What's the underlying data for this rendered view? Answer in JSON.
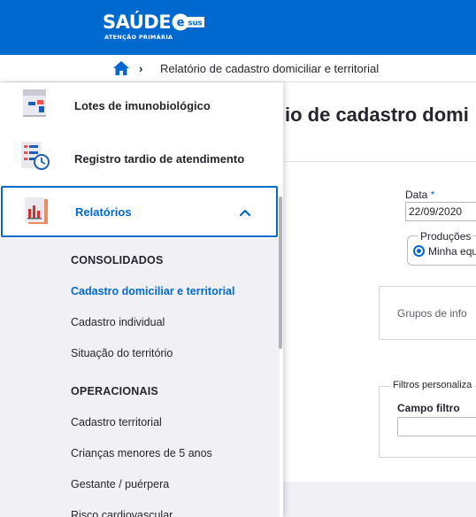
{
  "header": {
    "logo_text": "SAÚDE",
    "logo_sub": "ATENÇÃO PRIMÁRIA",
    "logo_badge": "sus",
    "brand_color": "#0069d0"
  },
  "breadcrumb": {
    "home_icon": "home-icon",
    "separator": "›",
    "current": "Relatório de cadastro domiciliar e territorial"
  },
  "main": {
    "title": "io de cadastro domi",
    "date_label": "Data",
    "date_required": "*",
    "date_value": "22/09/2020",
    "productions_legend": "Produções",
    "productions_option": "Minha equ",
    "groups_text": "Grupos de info",
    "filters_legend": "Filtros personaliza",
    "field_label": "Campo filtro"
  },
  "side_menu": {
    "items": [
      {
        "label": "Lotes de imunobiológico",
        "icon": "vaccine-lot-icon"
      },
      {
        "label": "Registro tardio de atendimento",
        "icon": "late-record-icon"
      },
      {
        "label": "Relatórios",
        "icon": "reports-icon",
        "expanded": true
      }
    ],
    "submenu": {
      "consolidados_heading": "CONSOLIDADOS",
      "consolidados": [
        {
          "label": "Cadastro domiciliar e territorial",
          "active": true
        },
        {
          "label": "Cadastro individual"
        },
        {
          "label": "Situação do território"
        }
      ],
      "operacionais_heading": "OPERACIONAIS",
      "operacionais": [
        {
          "label": "Cadastro territorial"
        },
        {
          "label": "Crianças menores de 5 anos"
        },
        {
          "label": "Gestante / puérpera"
        },
        {
          "label": "Risco cardiovascular"
        }
      ]
    }
  }
}
